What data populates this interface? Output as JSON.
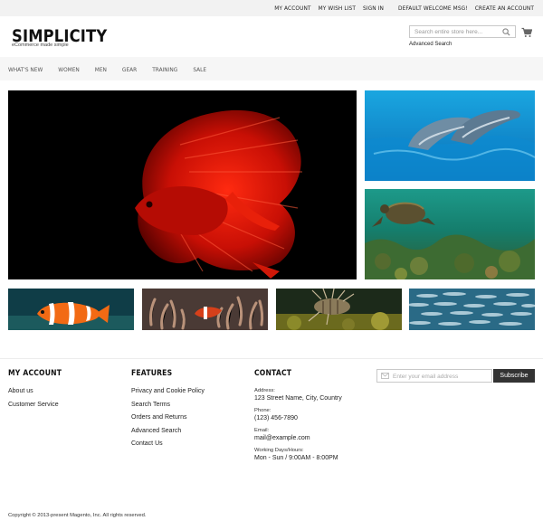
{
  "top_links": [
    "MY ACCOUNT",
    "MY WISH LIST",
    "SIGN IN",
    "DEFAULT WELCOME MSG!",
    "CREATE AN ACCOUNT"
  ],
  "header": {
    "logo": "SIMPLICITY",
    "tagline": "eCommerce made simple",
    "search_placeholder": "Search entire store here...",
    "advanced_search": "Advanced Search"
  },
  "nav": [
    "WHAT'S NEW",
    "WOMEN",
    "MEN",
    "GEAR",
    "TRAINING",
    "SALE"
  ],
  "footer": {
    "my_account": {
      "title": "MY ACCOUNT",
      "links": [
        "About us",
        "Customer Service"
      ]
    },
    "features": {
      "title": "FEATURES",
      "links": [
        "Privacy and Cookie Policy",
        "Search Terms",
        "Orders and Returns",
        "Advanced Search",
        "Contact Us"
      ]
    },
    "contact": {
      "title": "CONTACT",
      "address_label": "Address:",
      "address": "123 Street Name, City, Country",
      "phone_label": "Phone:",
      "phone": "(123) 456-7890",
      "email_label": "Email:",
      "email": "mail@example.com",
      "hours_label": "Working Days/Hours:",
      "hours": "Mon - Sun / 9:00AM - 8:00PM"
    },
    "newsletter_placeholder": "Enter your email address",
    "subscribe": "Subscribe"
  },
  "copyright": "Copyright © 2013-present Magento, Inc. All rights reserved.",
  "colors": {
    "accent": "#333333",
    "topbar": "#f2f2f2",
    "nav": "#f6f6f6"
  }
}
